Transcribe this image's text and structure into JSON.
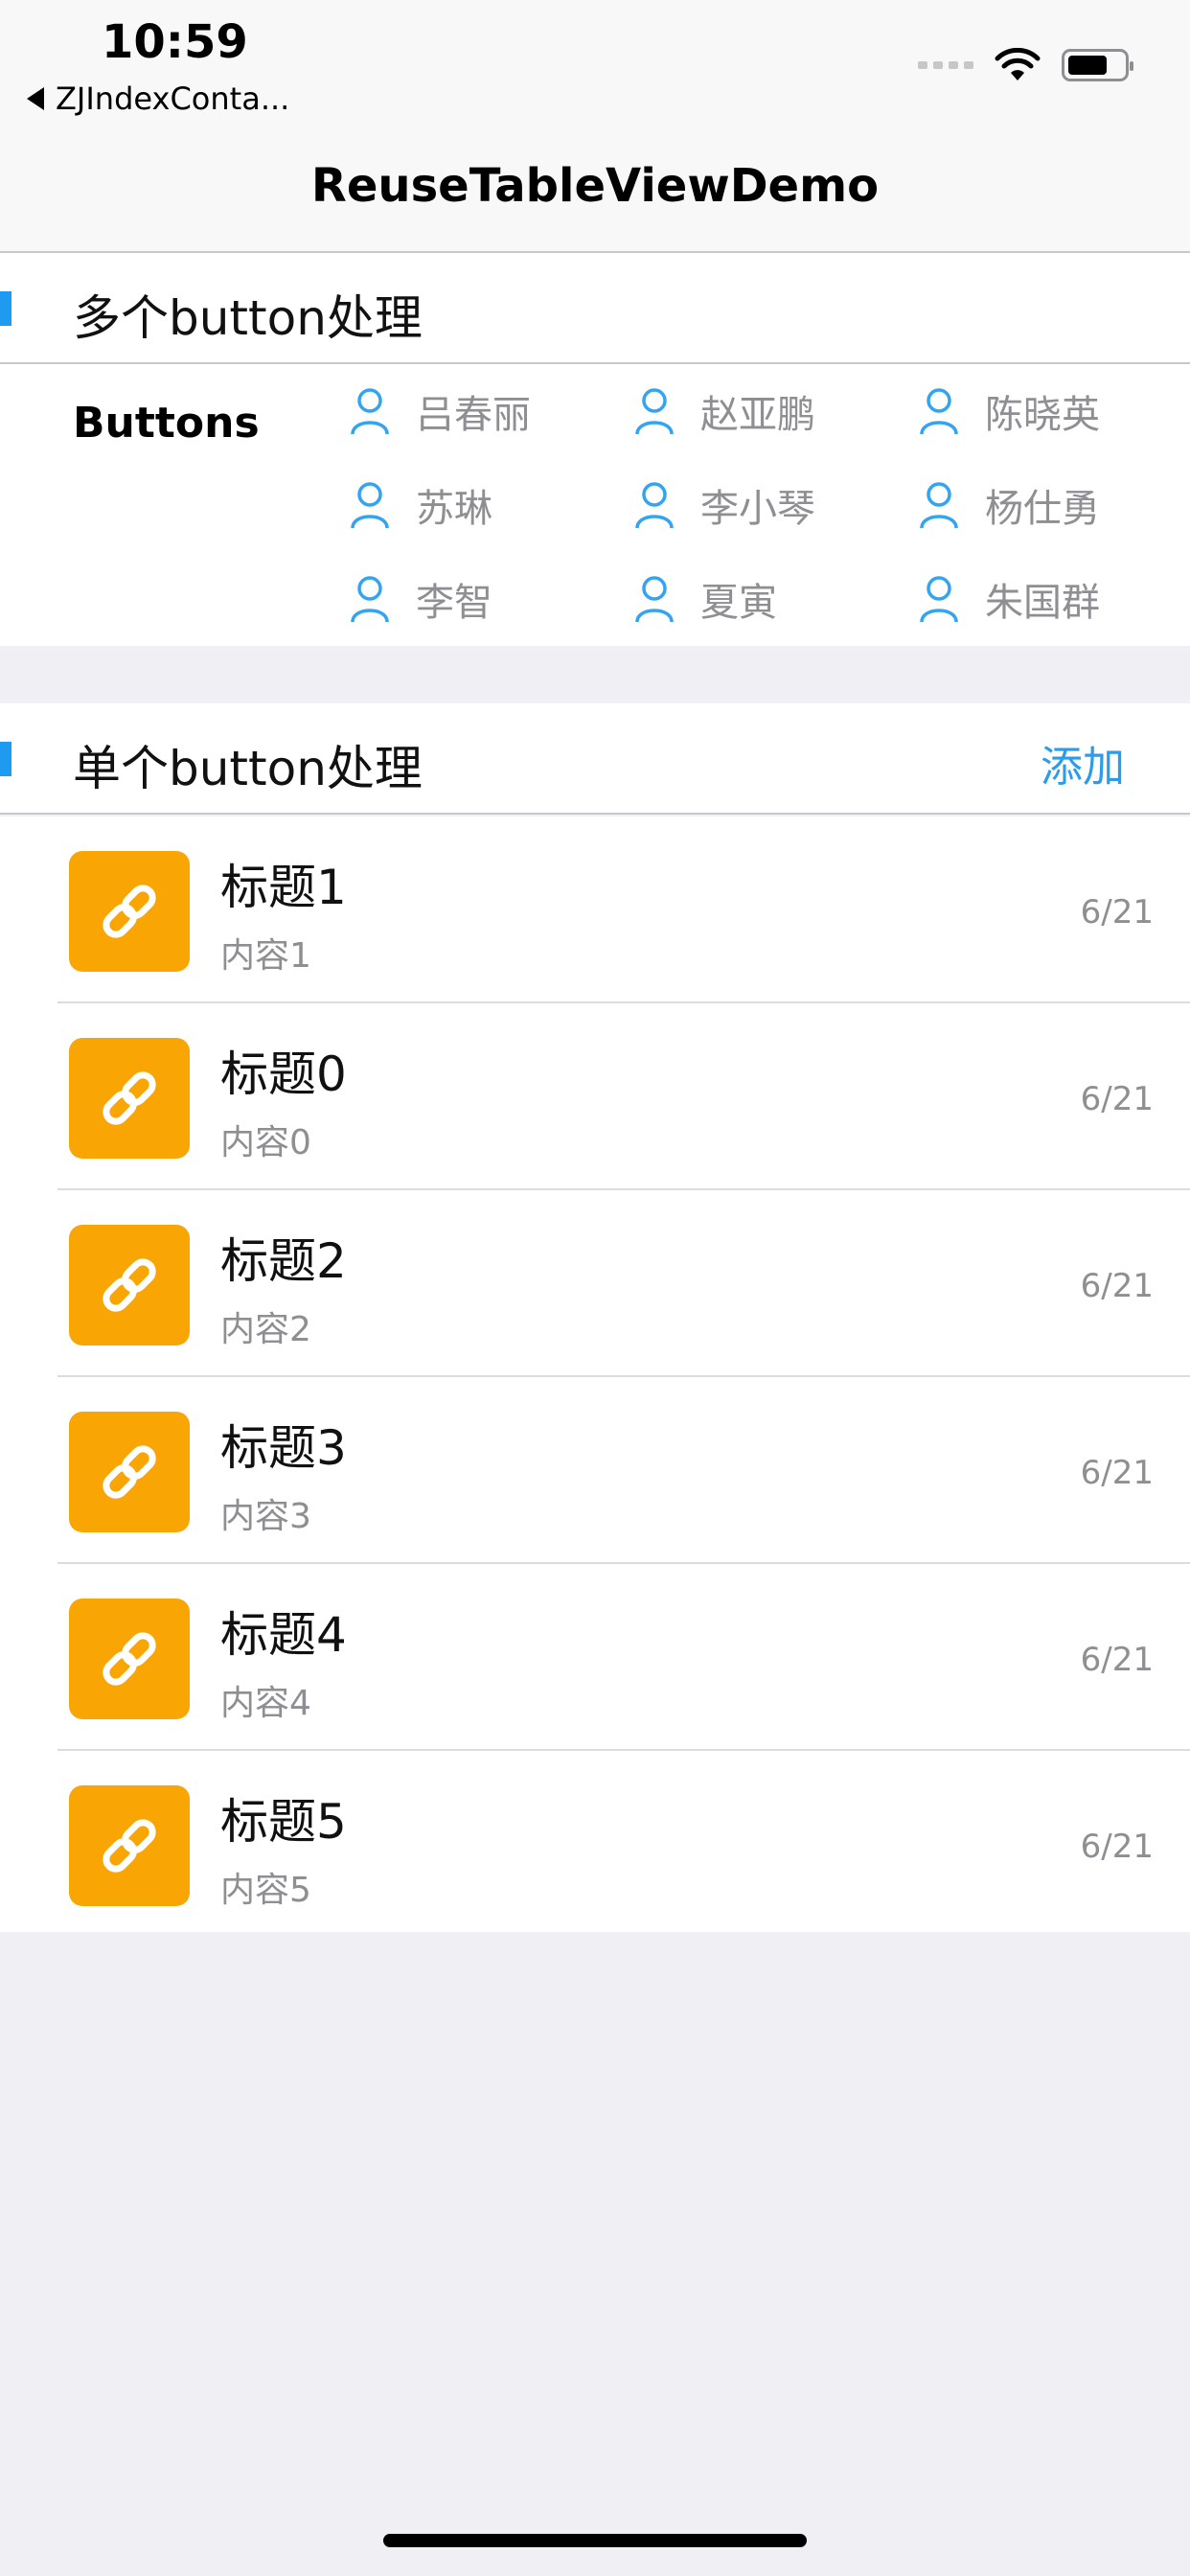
{
  "status_bar": {
    "time": "10:59",
    "back_app": "ZJIndexConta..."
  },
  "nav": {
    "title": "ReuseTableViewDemo"
  },
  "section1": {
    "header": "多个button处理",
    "label": "Buttons",
    "people": [
      "吕春丽",
      "赵亚鹏",
      "陈晓英",
      "苏琳",
      "李小琴",
      "杨仕勇",
      "李智",
      "夏寅",
      "朱国群"
    ]
  },
  "section2": {
    "header": "单个button处理",
    "action": "添加",
    "rows": [
      {
        "title": "标题1",
        "subtitle": "内容1",
        "date": "6/21"
      },
      {
        "title": "标题0",
        "subtitle": "内容0",
        "date": "6/21"
      },
      {
        "title": "标题2",
        "subtitle": "内容2",
        "date": "6/21"
      },
      {
        "title": "标题3",
        "subtitle": "内容3",
        "date": "6/21"
      },
      {
        "title": "标题4",
        "subtitle": "内容4",
        "date": "6/21"
      },
      {
        "title": "标题5",
        "subtitle": "内容5",
        "date": "6/21"
      }
    ]
  },
  "colors": {
    "accent": "#1e9bf0",
    "thumb": "#f9a504",
    "background": "#efeff4"
  },
  "icons": {
    "person": "person-outline-icon",
    "row": "link-icon"
  }
}
